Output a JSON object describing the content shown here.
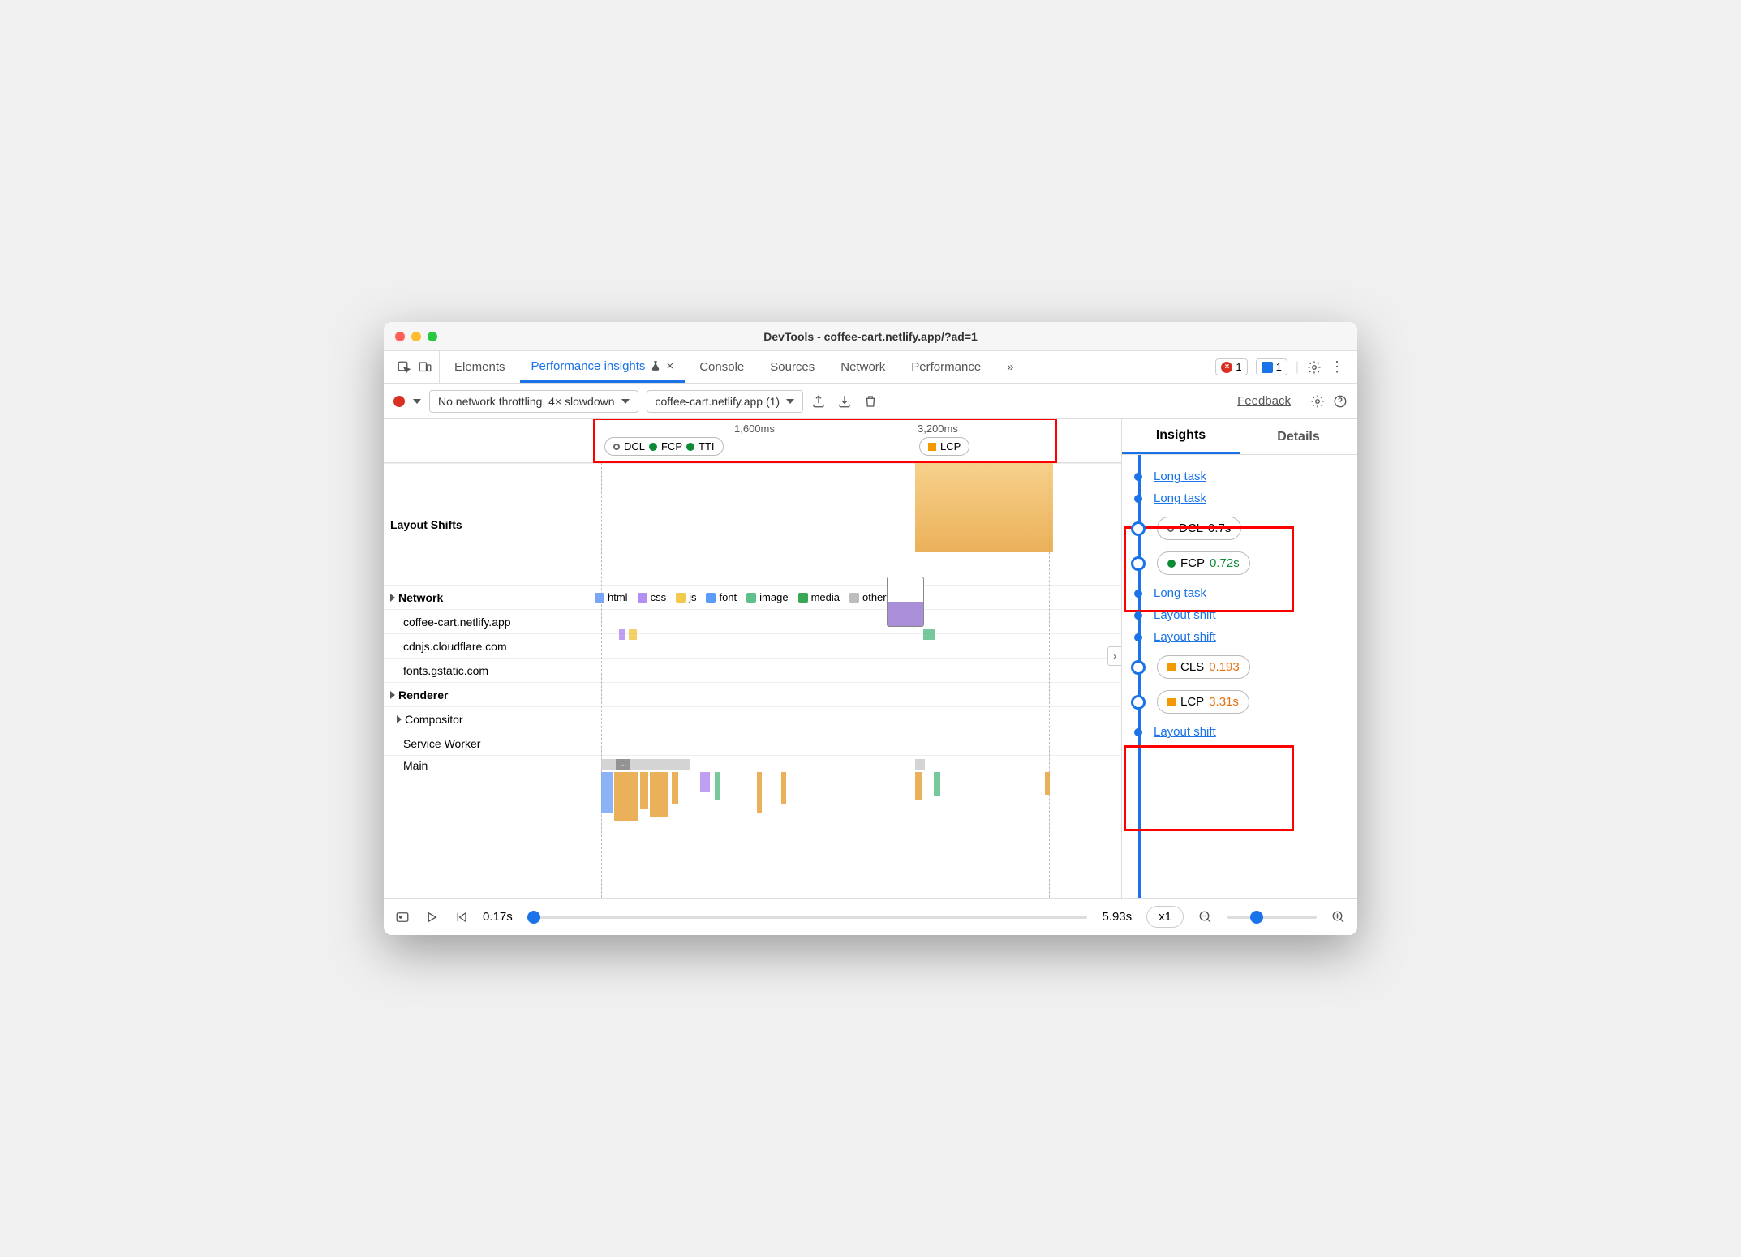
{
  "window": {
    "title": "DevTools - coffee-cart.netlify.app/?ad=1"
  },
  "tabbar": {
    "tabs": [
      "Elements",
      "Performance insights",
      "Console",
      "Sources",
      "Network",
      "Performance"
    ],
    "overflow": "»",
    "errors": "1",
    "messages": "1"
  },
  "toolbar": {
    "throttle": "No network throttling, 4× slowdown",
    "session": "coffee-cart.netlify.app (1)",
    "feedback": "Feedback"
  },
  "ruler": {
    "tick1": "1,600ms",
    "tick2": "3,200ms",
    "pill1_a": "DCL",
    "pill1_b": "FCP",
    "pill1_c": "TTI",
    "pill2": "LCP"
  },
  "tracks": {
    "layout_shifts": "Layout Shifts",
    "network": "Network",
    "legend": {
      "html": "html",
      "css": "css",
      "js": "js",
      "font": "font",
      "image": "image",
      "media": "media",
      "other": "other"
    },
    "net_rows": [
      "coffee-cart.netlify.app",
      "cdnjs.cloudflare.com",
      "fonts.gstatic.com"
    ],
    "renderer": "Renderer",
    "compositor": "Compositor",
    "sw": "Service Worker",
    "main": "Main"
  },
  "insights": {
    "tab1": "Insights",
    "tab2": "Details",
    "items": [
      {
        "kind": "link",
        "text": "Long task"
      },
      {
        "kind": "link",
        "text": "Long task"
      },
      {
        "kind": "pill",
        "marker": "hollow",
        "label": "DCL",
        "value": "0.7s",
        "cls": ""
      },
      {
        "kind": "pill",
        "marker": "green",
        "label": "FCP",
        "value": "0.72s",
        "cls": "val-green"
      },
      {
        "kind": "link",
        "text": "Long task"
      },
      {
        "kind": "link",
        "text": "Layout shift"
      },
      {
        "kind": "link",
        "text": "Layout shift"
      },
      {
        "kind": "pill",
        "marker": "sq",
        "label": "CLS",
        "value": "0.193",
        "cls": "val-orange"
      },
      {
        "kind": "pill",
        "marker": "sq",
        "label": "LCP",
        "value": "3.31s",
        "cls": "val-orange"
      },
      {
        "kind": "link",
        "text": "Layout shift"
      }
    ]
  },
  "bottom": {
    "t_start": "0.17s",
    "t_end": "5.93s",
    "speed": "x1"
  },
  "colors": {
    "html": "#79a6f6",
    "css": "#b48ef0",
    "js": "#f2c94c",
    "font": "#5a9cf8",
    "image": "#5fc08b",
    "media": "#3aa757",
    "other": "#bdbdbd"
  }
}
